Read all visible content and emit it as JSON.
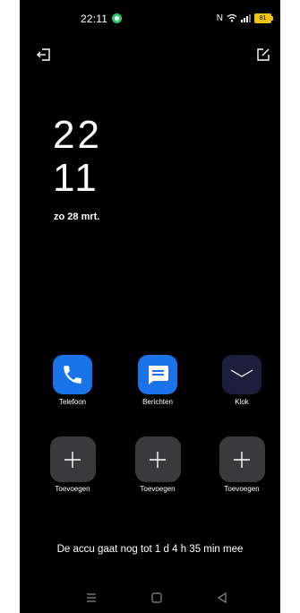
{
  "status_bar": {
    "time": "22:11",
    "nfc_icon": "N",
    "battery_level": "81"
  },
  "top_bar": {
    "exit_icon": "exit-icon",
    "edit_icon": "edit-icon"
  },
  "clock": {
    "hours": "22",
    "minutes": "11",
    "date": "zo 28 mrt."
  },
  "apps": [
    {
      "label": "Telefoon",
      "icon": "phone-icon",
      "color": "#1a73e8"
    },
    {
      "label": "Berichten",
      "icon": "messages-icon",
      "color": "#1a73e8"
    },
    {
      "label": "Klok",
      "icon": "clock-icon",
      "color": "#1b1f3b"
    }
  ],
  "add_slots": [
    {
      "label": "Toevoegen"
    },
    {
      "label": "Toevoegen"
    },
    {
      "label": "Toevoegen"
    }
  ],
  "battery_message": "De accu gaat nog tot 1 d 4 h 35 min mee",
  "nav_bar": {
    "menu_icon": "menu-icon",
    "home_icon": "home-icon",
    "back_icon": "back-icon"
  }
}
